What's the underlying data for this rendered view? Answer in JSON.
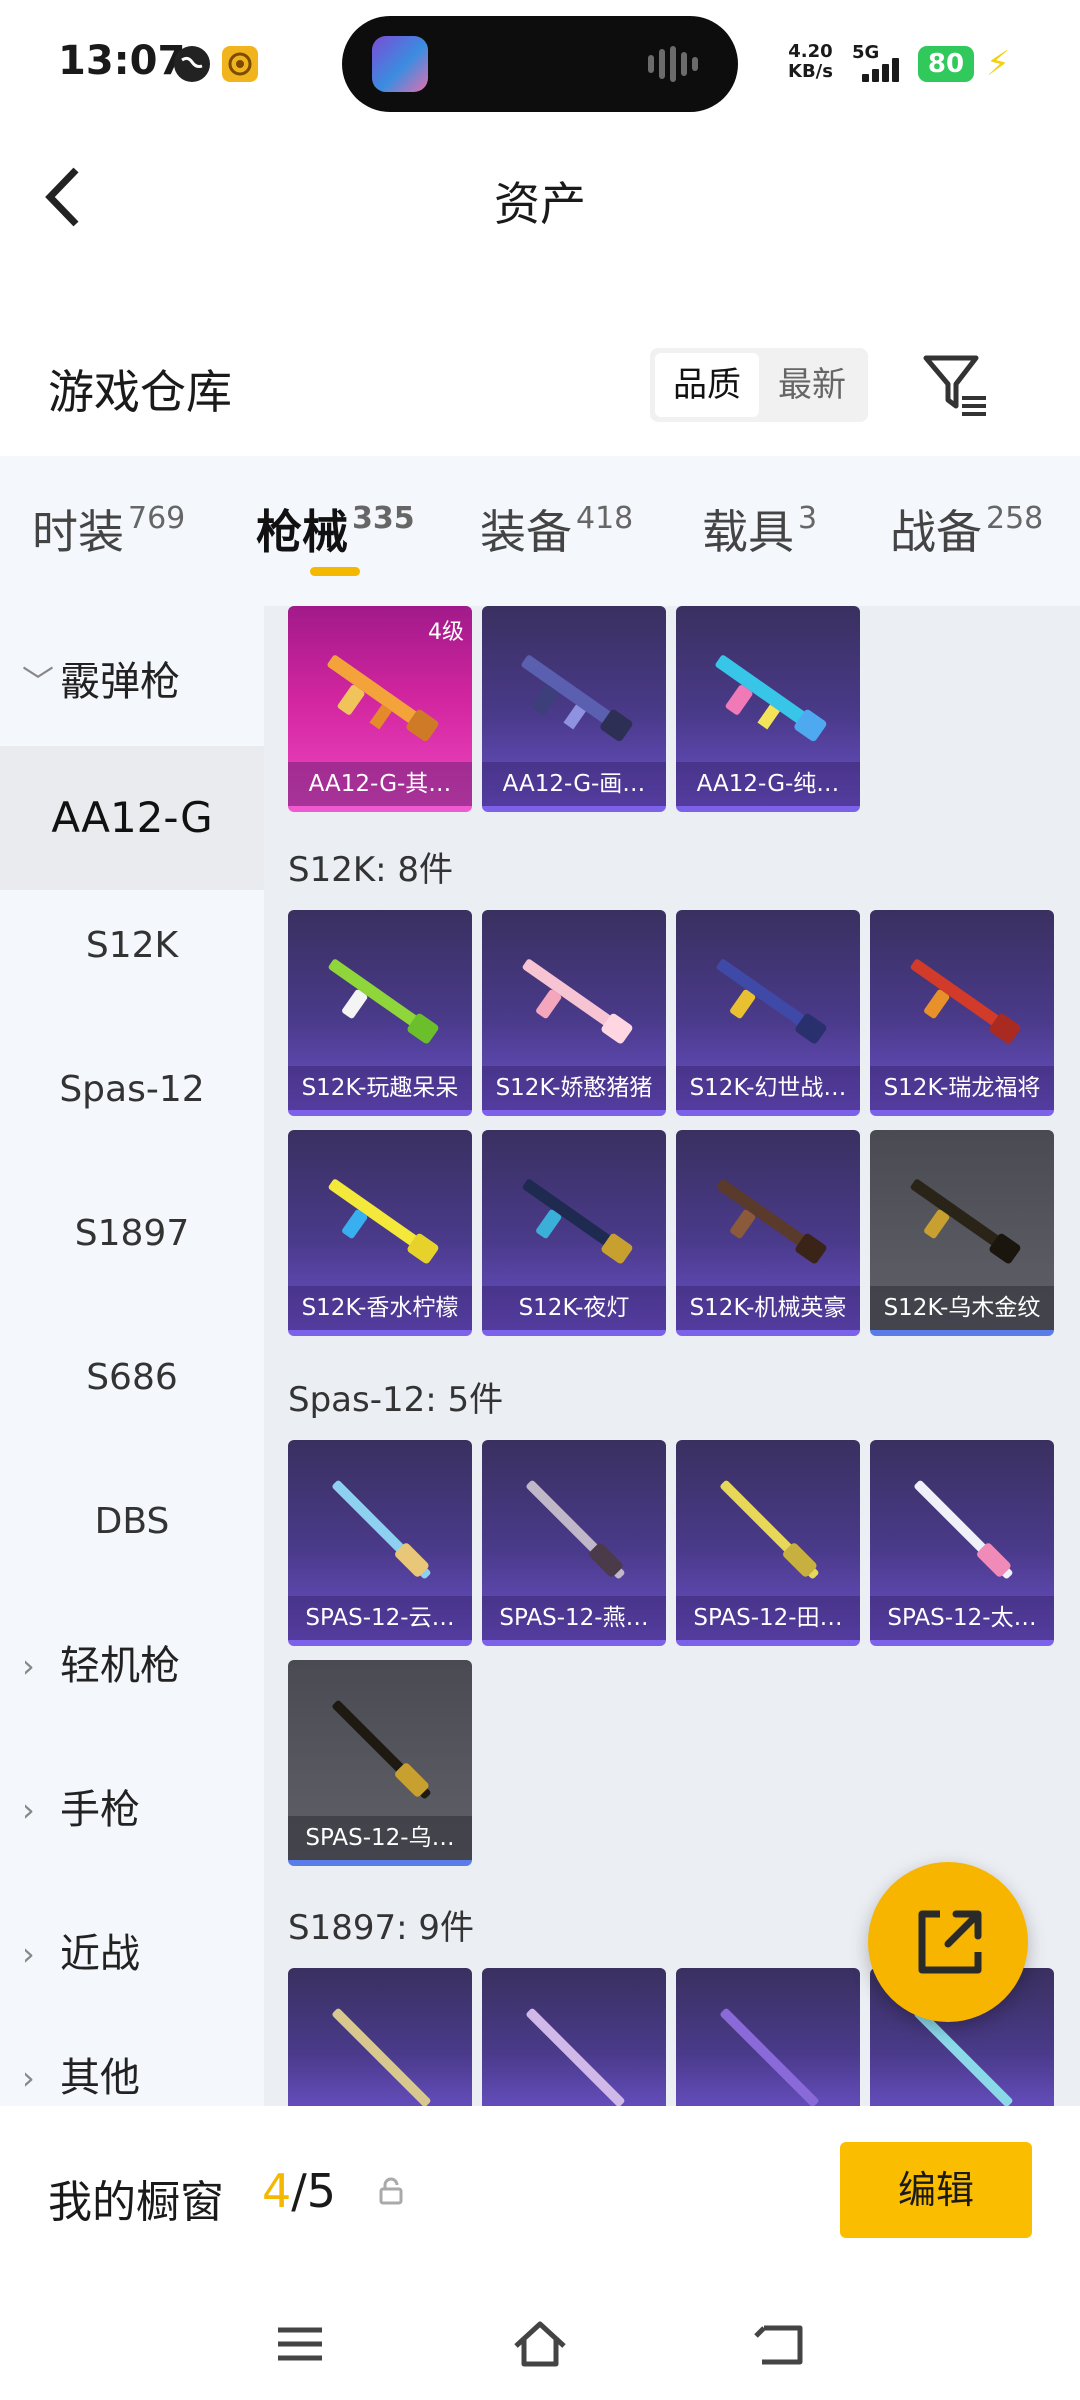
{
  "status_bar": {
    "time": "13:07",
    "net_speed_value": "4.20",
    "net_speed_unit": "KB/s",
    "network": "5G",
    "battery": "80"
  },
  "header": {
    "back_icon": "chevron-left-icon",
    "title": "资产"
  },
  "warehouse": {
    "title": "游戏仓库",
    "sort_options": [
      "品质",
      "最新"
    ],
    "sort_selected": "品质",
    "filter_icon": "filter-icon"
  },
  "tabs": [
    {
      "label": "时装",
      "count": "769"
    },
    {
      "label": "枪械",
      "count": "335",
      "active": true
    },
    {
      "label": "装备",
      "count": "418"
    },
    {
      "label": "载具",
      "count": "3"
    },
    {
      "label": "战备",
      "count": "258"
    }
  ],
  "sidebar": {
    "group_shotgun": "霰弹枪",
    "items": [
      "AA12-G",
      "S12K",
      "Spas-12",
      "S1897",
      "S686",
      "DBS"
    ],
    "group_lmg": "轻机枪",
    "group_pistol": "手枪",
    "group_melee": "近战",
    "group_other_partial": "其他"
  },
  "content": {
    "aa12_cards": [
      {
        "label": "AA12-G-其…",
        "badge": "4级"
      },
      {
        "label": "AA12-G-画…"
      },
      {
        "label": "AA12-G-纯…"
      }
    ],
    "s12k_header": "S12K: 8件",
    "s12k_cards": [
      "S12K-玩趣呆呆",
      "S12K-娇憨猪猪",
      "S12K-幻世战…",
      "S12K-瑞龙福将",
      "S12K-香水柠檬",
      "S12K-夜灯",
      "S12K-机械英豪",
      "S12K-乌木金纹"
    ],
    "spas_header": "Spas-12: 5件",
    "spas_cards": [
      "SPAS-12-云…",
      "SPAS-12-燕…",
      "SPAS-12-田…",
      "SPAS-12-太…",
      "SPAS-12-乌…"
    ],
    "s1897_header": "S1897: 9件"
  },
  "fab_icon": "share-external-icon",
  "showcase": {
    "label": "我的橱窗",
    "current": "4",
    "separator": "/",
    "total": "5",
    "edit_label": "编辑"
  },
  "colors": {
    "accent": "#f5b800",
    "purple_card": "#4a3a8a",
    "gold_card": "#d1259f"
  }
}
